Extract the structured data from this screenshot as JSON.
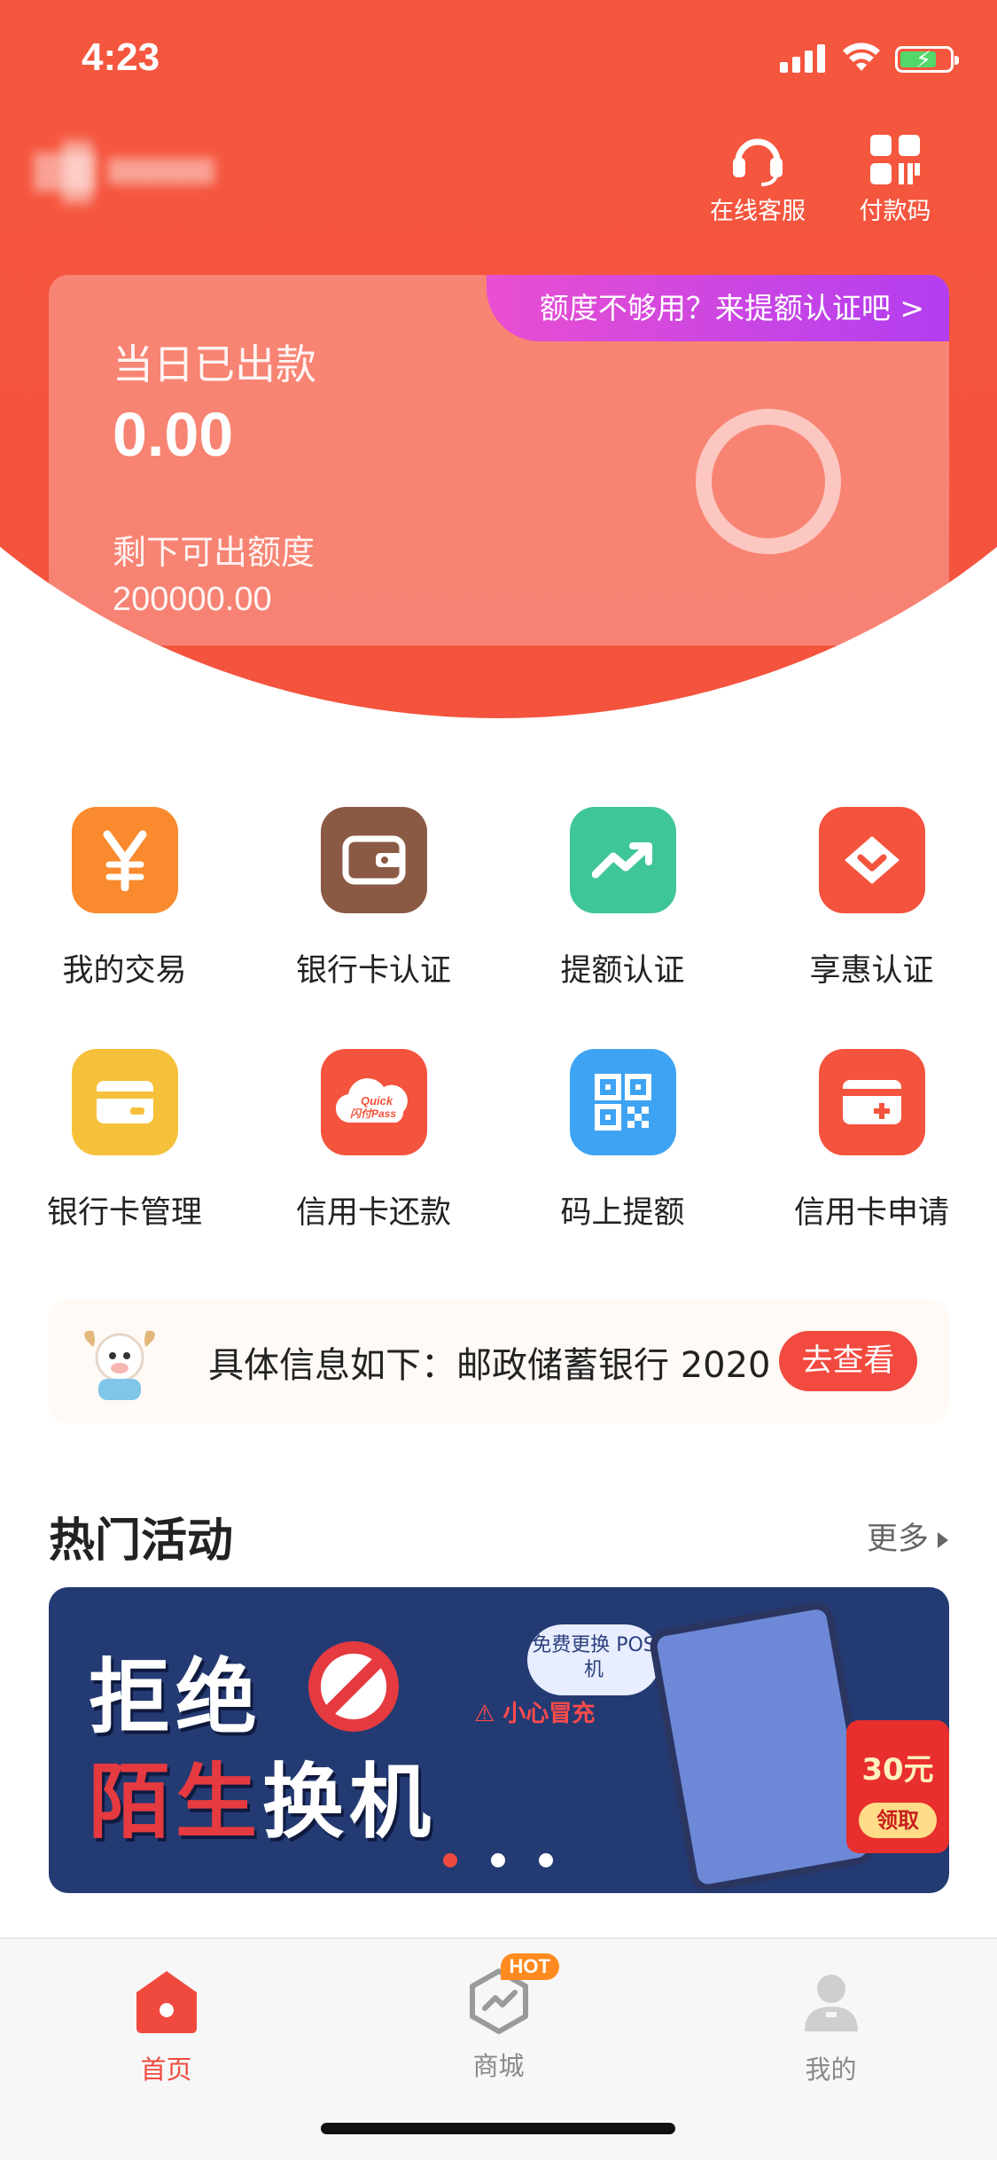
{
  "status_bar": {
    "time": "4:23"
  },
  "header": {
    "actions": [
      {
        "label": "在线客服",
        "icon": "headset-icon"
      },
      {
        "label": "付款码",
        "icon": "qr-payment-icon"
      }
    ]
  },
  "quota_card": {
    "promo": "额度不够用？来提额认证吧 >",
    "today_label": "当日已出款",
    "today_value": "0.00",
    "remaining_label": "剩下可出额度",
    "remaining_value": "200000.00",
    "used_fraction": 0
  },
  "grid": {
    "items": [
      {
        "label": "我的交易",
        "icon": "yen-icon",
        "color": "#f98a2d"
      },
      {
        "label": "银行卡认证",
        "icon": "wallet-icon",
        "color": "#8b5a45"
      },
      {
        "label": "提额认证",
        "icon": "trend-up-icon",
        "color": "#3ec69a"
      },
      {
        "label": "享惠认证",
        "icon": "diamond-icon",
        "color": "#f4533d"
      },
      {
        "label": "银行卡管理",
        "icon": "card-icon",
        "color": "#f6c13a"
      },
      {
        "label": "信用卡还款",
        "icon": "quickpass-icon",
        "color": "#f4533d"
      },
      {
        "label": "码上提额",
        "icon": "qr-code-icon",
        "color": "#3ea3f3"
      },
      {
        "label": "信用卡申请",
        "icon": "card-add-icon",
        "color": "#f4533d"
      }
    ]
  },
  "notice": {
    "text": "具体信息如下：邮政储蓄银行 2020",
    "button": "去查看"
  },
  "hot_section": {
    "title": "热门活动",
    "more": "更多"
  },
  "banner": {
    "line1": "拒绝",
    "line2_red": "陌生",
    "line2_white": "换机",
    "cloud_text": "免费更换 POS机",
    "warn_text": "小心冒充",
    "coupon_amount": "30元",
    "coupon_get": "领取",
    "slide_count": 3,
    "active_slide": 1
  },
  "tabbar": {
    "tabs": [
      {
        "label": "首页",
        "icon": "home-icon",
        "active": true
      },
      {
        "label": "商城",
        "icon": "mall-icon",
        "active": false,
        "badge": "HOT"
      },
      {
        "label": "我的",
        "icon": "profile-icon",
        "active": false
      }
    ]
  },
  "colors": {
    "brand_red": "#f4533d",
    "promo_purple": "#b23ef0",
    "active_tab": "#f04a3f"
  }
}
